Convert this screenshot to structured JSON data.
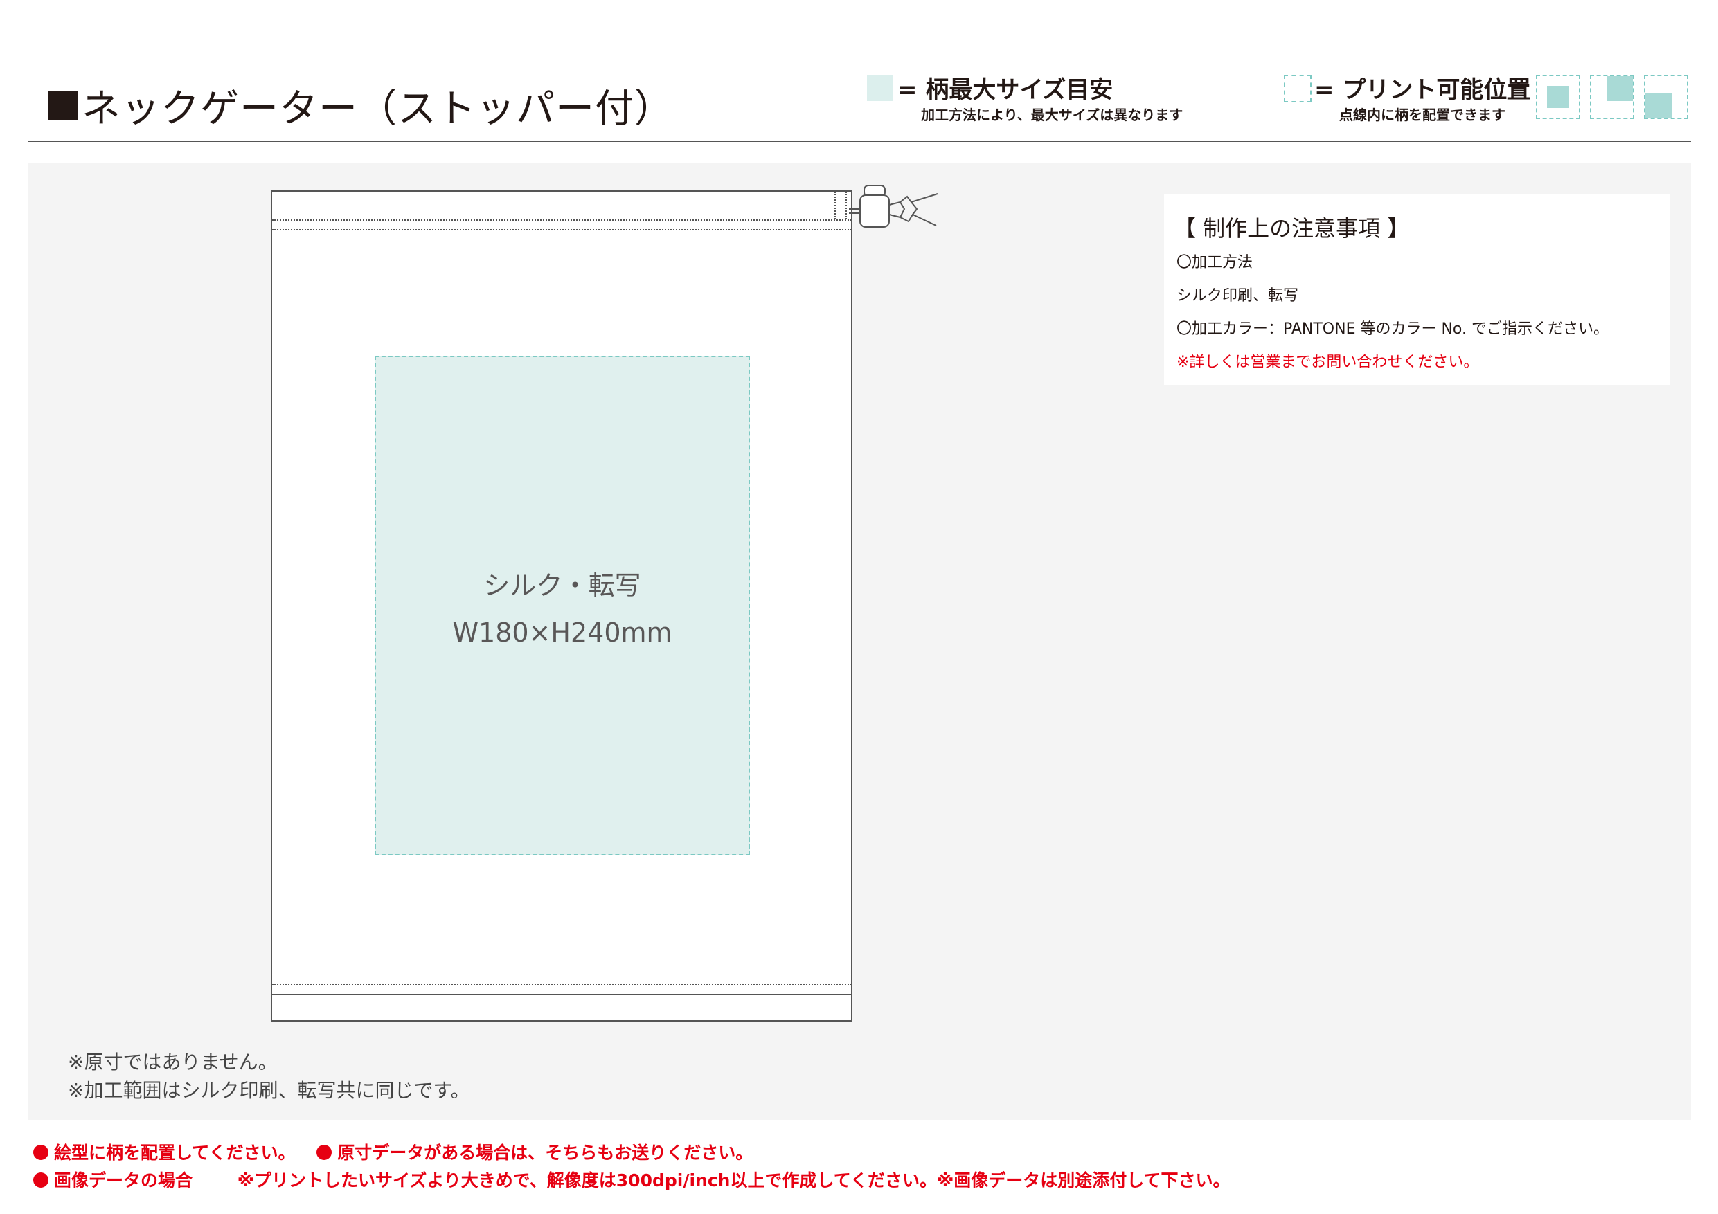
{
  "header": {
    "title": "ネックゲーター（ストッパー付）",
    "legend_max": {
      "label": "= 柄最大サイズ目安",
      "note": "加工方法により、最大サイズは異なります"
    },
    "legend_print": {
      "label": "= プリント可能位置",
      "note": "点線内に柄を配置できます"
    }
  },
  "print_area": {
    "method": "シルク・転写",
    "size": "W180×H240mm"
  },
  "notes": {
    "heading": "【 制作上の注意事項 】",
    "lines": [
      "〇加工方法",
      "シルク印刷、転写",
      "〇加工カラー：PANTONE 等のカラー No. でご指示ください。"
    ],
    "contact": "※詳しくは営業までお問い合わせください。"
  },
  "disclaimers": [
    "※原寸ではありません。",
    "※加工範囲はシルク印刷、転写共に同じです。"
  ],
  "footer": {
    "line1_a": "絵型に柄を配置してください。",
    "line1_b": "原寸データがある場合は、そちらもお送りください。",
    "line2_a": "画像データの場合",
    "line2_b": "※プリントしたいサイズより大きめで、解像度は300dpi/inch以上で作成してください。※画像データは別途添付して下さい。"
  },
  "colors": {
    "print_area_fill": "#e0f0ee",
    "print_area_border": "#7cc9c3",
    "alert_red": "#e60012"
  }
}
